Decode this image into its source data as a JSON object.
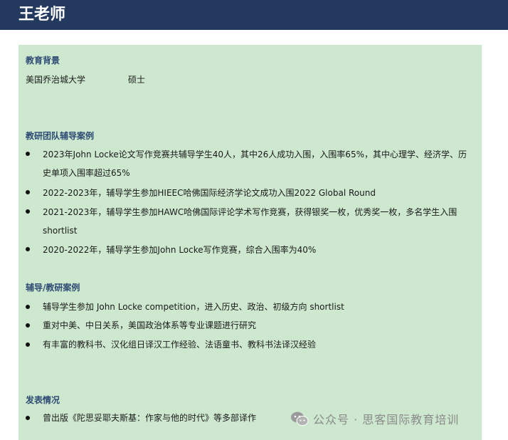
{
  "header": {
    "title": "王老师"
  },
  "education": {
    "heading": "教育背景",
    "school": "美国乔治城大学",
    "degree": "硕士"
  },
  "team_cases": {
    "heading": "教研团队辅导案例",
    "items": [
      "2023年John Locke论文写作竞赛共辅导学生40人，其中26人成功入围，入围率65%，其中心理学、经济学、历史单项入围率超过65%",
      "2022-2023年，辅导学生参加HIEEC哈佛国际经济学论文成功入围2022 Global Round",
      "2021-2023年，辅导学生参加HAWC哈佛国际评论学术写作竞赛，获得银奖一枚，优秀奖一枚，多名学生入围shortlist",
      "2020-2022年，辅导学生参加John Locke写作竞赛，综合入围率为40%"
    ]
  },
  "tutoring_cases": {
    "heading": "辅导/教研案例",
    "items": [
      "辅导学生参加 John Locke competition，进入历史、政治、初级方向 shortlist",
      "重对中美、中日关系，美国政治体系等专业课题进行研究",
      "有丰富的教科书、汉化组日译汉工作经验、法语童书、教科书法译汉经验"
    ]
  },
  "publications": {
    "heading": "发表情况",
    "items": [
      "曾出版《陀思妥耶夫斯基：作家与他的时代》等多部译作"
    ]
  },
  "watermark": {
    "icon": "wechat-icon",
    "text": "公众号 · 思客国际教育培训"
  },
  "colors": {
    "header_bg": "#233a5e",
    "panel_bg": "#cde8cf",
    "heading_text": "#2d4a73"
  }
}
